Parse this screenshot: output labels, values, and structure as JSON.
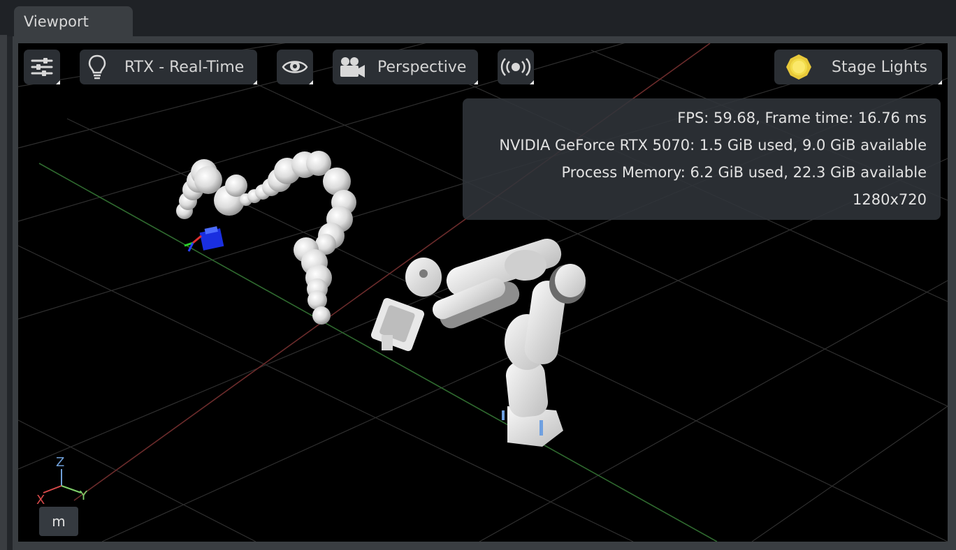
{
  "tab": {
    "label": "Viewport"
  },
  "toolbar": {
    "settings_icon": "sliders-icon",
    "render_icon": "lightbulb-icon",
    "render_mode_label": "RTX - Real-Time",
    "visibility_icon": "eye-icon",
    "camera_icon": "movie-camera-icon",
    "camera_label": "Perspective",
    "broadcast_icon": "broadcast-icon",
    "lights_icon": "sun-icon",
    "lights_label": "Stage Lights"
  },
  "stats": {
    "fps_line": "FPS: 59.68, Frame time: 16.76 ms",
    "gpu_line": "NVIDIA GeForce RTX 5070: 1.5 GiB used, 9.0 GiB available",
    "memory_line": "Process Memory: 6.2 GiB used, 22.3 GiB available",
    "resolution_line": "1280x720"
  },
  "axis_gizmo": {
    "x_label": "X",
    "y_label": "Y",
    "z_label": "Z"
  },
  "units": {
    "label": "m"
  },
  "colors": {
    "background": "#000000",
    "panel": "#3a3e42",
    "button": "#2b2f34",
    "x_axis": "#d84a4a",
    "y_axis": "#7fcf6a",
    "z_axis": "#6f9fd8",
    "lights_accent": "#f2dc4a"
  }
}
